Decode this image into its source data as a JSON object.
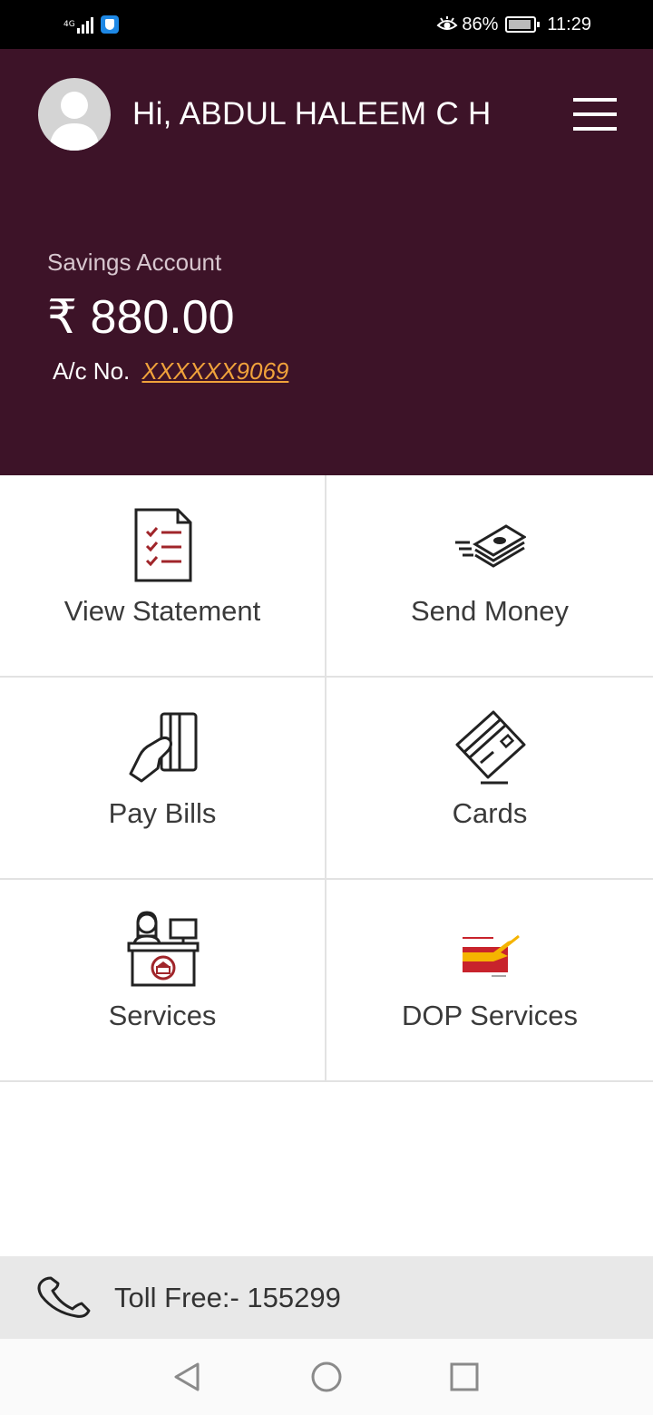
{
  "status_bar": {
    "network": "4G",
    "battery_percent": "86%",
    "time": "11:29",
    "icons": [
      "signal-icon",
      "app-shield-icon",
      "eye-comfort-icon",
      "battery-icon"
    ]
  },
  "header": {
    "greeting": "Hi, ABDUL HALEEM C H",
    "account_type": "Savings Account",
    "balance": "₹ 880.00",
    "account_number_label": "A/c No.",
    "account_number": "XXXXXX9069",
    "background_color": "#3d1328",
    "link_color": "#f0a23b"
  },
  "tiles": [
    {
      "label": "View Statement",
      "icon": "statement-checklist-icon"
    },
    {
      "label": "Send Money",
      "icon": "money-stack-icon"
    },
    {
      "label": "Pay Bills",
      "icon": "hand-card-icon"
    },
    {
      "label": "Cards",
      "icon": "credit-card-icon"
    },
    {
      "label": "Services",
      "icon": "bank-counter-icon"
    },
    {
      "label": "DOP Services",
      "icon": "india-post-logo-icon"
    }
  ],
  "footer": {
    "toll_free": "Toll Free:- 155299"
  },
  "nav_bar": {
    "buttons": [
      "back-icon",
      "home-icon",
      "recents-icon"
    ]
  }
}
